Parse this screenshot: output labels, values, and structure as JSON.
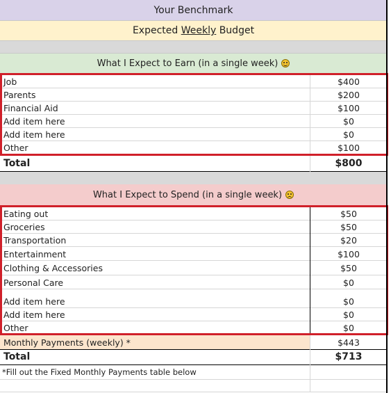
{
  "header": {
    "title": "Your Benchmark",
    "subtitle_prefix": "Expected ",
    "subtitle_underlined": "Weekly",
    "subtitle_suffix": " Budget"
  },
  "earn": {
    "heading": "What I Expect to Earn (in a single week)",
    "emoji": "smile-emoji-icon",
    "items": [
      {
        "label": "Job",
        "value": "$400"
      },
      {
        "label": "Parents",
        "value": "$200"
      },
      {
        "label": "Financial Aid",
        "value": "$100"
      },
      {
        "label": "Add item here",
        "value": "$0"
      },
      {
        "label": "Add item here",
        "value": "$0"
      },
      {
        "label": "Other",
        "value": "$100"
      }
    ],
    "total_label": "Total",
    "total_value": "$800"
  },
  "spend": {
    "heading": "What I Expect to Spend (in a single week)",
    "emoji": "frown-emoji-icon",
    "items": [
      {
        "label": "Eating out",
        "value": "$50"
      },
      {
        "label": "Groceries",
        "value": "$50"
      },
      {
        "label": "Transportation",
        "value": "$20"
      },
      {
        "label": "Entertainment",
        "value": "$100"
      },
      {
        "label": "Clothing & Accessories",
        "value": "$50"
      },
      {
        "label": "Personal Care",
        "value": "$0"
      },
      {
        "label": "Add item here",
        "value": "$0"
      },
      {
        "label": "Add item here",
        "value": "$0"
      },
      {
        "label": "Other",
        "value": "$0"
      }
    ],
    "monthly_label": "Monthly Payments (weekly) *",
    "monthly_value": "$443",
    "total_label": "Total",
    "total_value": "$713",
    "footnote": "*Fill out the Fixed Monthly Payments table below"
  },
  "colors": {
    "title_bg": "#d9d2e9",
    "subtitle_bg": "#fff2cc",
    "gray_bg": "#d9d9d9",
    "earn_bg": "#d9ead3",
    "spend_bg": "#f4cccc",
    "monthly_bg": "#fce5cd",
    "highlight_border": "#d0202a"
  }
}
